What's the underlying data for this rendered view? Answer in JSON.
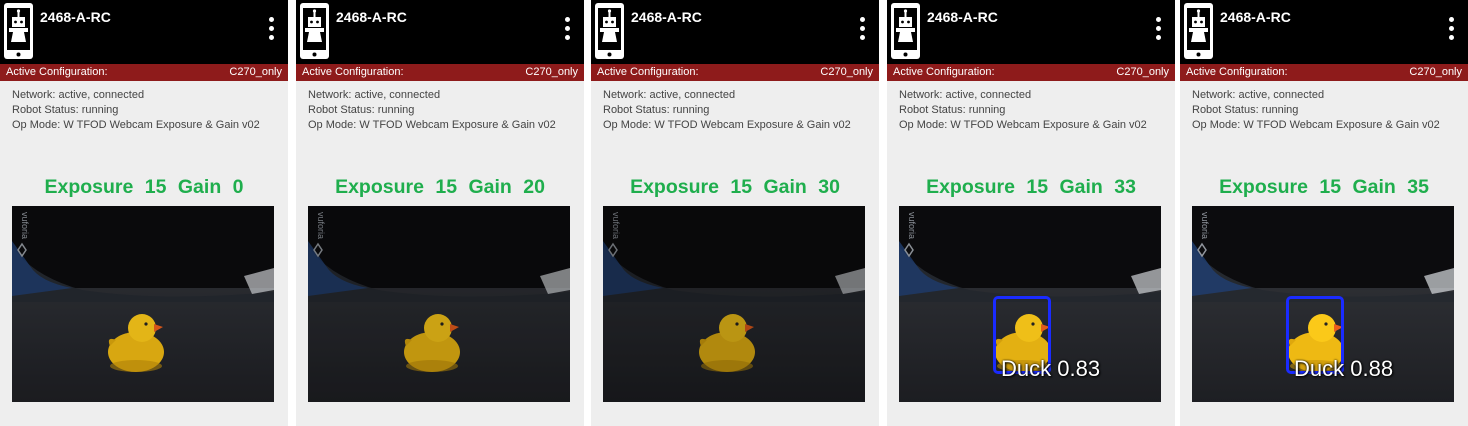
{
  "colors": {
    "topbar": "#000000",
    "config_bar": "#8e1b1b",
    "caption": "#1fae4d",
    "detection_box": "#1a2bff",
    "panel_bg": "#eeeeee"
  },
  "panels": [
    {
      "device_name": "2468-A-RC",
      "config_label": "Active Configuration:",
      "config_value": "C270_only",
      "network": "Network: active, connected",
      "robot_status": "Robot Status: running",
      "op_mode": "Op Mode: W TFOD Webcam Exposure & Gain v02",
      "caption": "Exposure 15  Gain 0",
      "camera_brightness": 0.95,
      "detection_label": ""
    },
    {
      "device_name": "2468-A-RC",
      "config_label": "Active Configuration:",
      "config_value": "C270_only",
      "network": "Network: active, connected",
      "robot_status": "Robot Status: running",
      "op_mode": "Op Mode: W TFOD Webcam Exposure & Gain v02",
      "caption": "Exposure 15  Gain 20",
      "camera_brightness": 0.85,
      "detection_label": ""
    },
    {
      "device_name": "2468-A-RC",
      "config_label": "Active Configuration:",
      "config_value": "C270_only",
      "network": "Network: active, connected",
      "robot_status": "Robot Status: running",
      "op_mode": "Op Mode: W TFOD Webcam Exposure & Gain v02",
      "caption": "Exposure 15  Gain 30",
      "camera_brightness": 0.78,
      "detection_label": ""
    },
    {
      "device_name": "2468-A-RC",
      "config_label": "Active Configuration:",
      "config_value": "C270_only",
      "network": "Network: active, connected",
      "robot_status": "Robot Status: running",
      "op_mode": "Op Mode: W TFOD Webcam Exposure & Gain v02",
      "caption": "Exposure 15  Gain 33",
      "camera_brightness": 1.0,
      "detection_label": "Duck 0.83"
    },
    {
      "device_name": "2468-A-RC",
      "config_label": "Active Configuration:",
      "config_value": "C270_only",
      "network": "Network: active, connected",
      "robot_status": "Robot Status: running",
      "op_mode": "Op Mode: W TFOD Webcam Exposure & Gain v02",
      "caption": "Exposure 15  Gain 35",
      "camera_brightness": 1.05,
      "detection_label": "Duck 0.88"
    }
  ]
}
